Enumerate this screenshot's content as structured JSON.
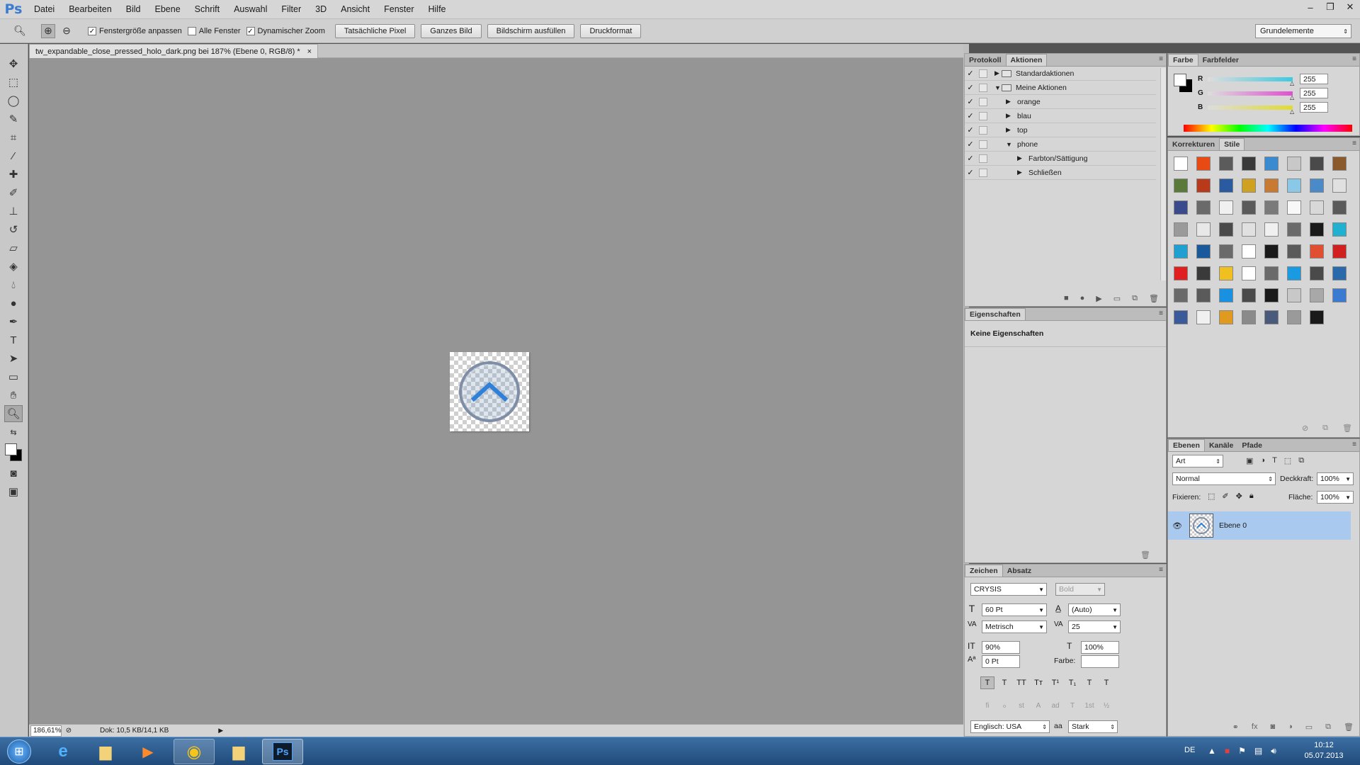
{
  "app": {
    "logo": "Ps",
    "menu": [
      "Datei",
      "Bearbeiten",
      "Bild",
      "Ebene",
      "Schrift",
      "Auswahl",
      "Filter",
      "3D",
      "Ansicht",
      "Fenster",
      "Hilfe"
    ],
    "window_controls": [
      "–",
      "❐",
      "✕"
    ]
  },
  "options": {
    "checks": [
      {
        "label": "Fenstergröße anpassen",
        "checked": true
      },
      {
        "label": "Alle Fenster",
        "checked": false
      },
      {
        "label": "Dynamischer Zoom",
        "checked": true
      }
    ],
    "buttons": [
      "Tatsächliche Pixel",
      "Ganzes Bild",
      "Bildschirm ausfüllen",
      "Druckformat"
    ],
    "workspace": "Grundelemente"
  },
  "document": {
    "tab_title": "tw_expandable_close_pressed_holo_dark.png bei 187% (Ebene 0, RGB/8) *",
    "close": "×",
    "zoom": "186,61%",
    "doc_info": "Dok: 10,5 KB/14,1 KB"
  },
  "actions_panel": {
    "tabs": [
      "Protokoll",
      "Aktionen"
    ],
    "rows": [
      {
        "label": "Standardaktionen",
        "indent": 0,
        "open": false,
        "folder": true
      },
      {
        "label": "Meine Aktionen",
        "indent": 0,
        "open": true,
        "folder": true
      },
      {
        "label": "orange",
        "indent": 1,
        "open": false,
        "folder": false
      },
      {
        "label": "blau",
        "indent": 1,
        "open": false,
        "folder": false
      },
      {
        "label": "top",
        "indent": 1,
        "open": false,
        "folder": false
      },
      {
        "label": "phone",
        "indent": 1,
        "open": true,
        "folder": false
      },
      {
        "label": "Farbton/Sättigung",
        "indent": 2,
        "open": false,
        "folder": false
      },
      {
        "label": "Schließen",
        "indent": 2,
        "open": false,
        "folder": false
      }
    ]
  },
  "properties_panel": {
    "tab": "Eigenschaften",
    "text": "Keine Eigenschaften"
  },
  "character_panel": {
    "tabs": [
      "Zeichen",
      "Absatz"
    ],
    "font": "CRYSIS",
    "style": "Bold",
    "size": "60 Pt",
    "leading": "(Auto)",
    "kerning": "Metrisch",
    "tracking": "25",
    "vscale": "90%",
    "hscale": "100%",
    "baseline": "0 Pt",
    "color_label": "Farbe:",
    "language": "Englisch: USA",
    "aa_label": "aa",
    "antialias": "Stark",
    "style_buttons": [
      "T",
      "T",
      "TT",
      "Tт",
      "T¹",
      "T₁",
      "T",
      "T"
    ],
    "opentype_buttons": [
      "fi",
      "ℴ",
      "st",
      "A",
      "ad",
      "T",
      "1st",
      "½"
    ]
  },
  "color_panel": {
    "tabs": [
      "Farbe",
      "Farbfelder"
    ],
    "channels": [
      {
        "label": "R",
        "value": "255",
        "color": "#3fc9e0"
      },
      {
        "label": "G",
        "value": "255",
        "color": "#e04fd0"
      },
      {
        "label": "B",
        "value": "255",
        "color": "#e0dc30"
      }
    ]
  },
  "styles_panel": {
    "tabs": [
      "Korrekturen",
      "Stile"
    ],
    "swatches": [
      "#ffffff",
      "#e84a14",
      "#5b5b5b",
      "#3a3a3a",
      "#3a8ad0",
      "#c8c8c8",
      "#4a4a4a",
      "#8a5a2a",
      "#5a7a3a",
      "#b83a1a",
      "#2a5aa0",
      "#d0a020",
      "#c87a30",
      "#8ac8e8",
      "#4a8ac8",
      "#e0e0e0",
      "#3a4a8a",
      "#6a6a6a",
      "#f0f0f0",
      "#5a5a5a",
      "#7a7a7a",
      "#f8f8f8",
      "#d8d8d8",
      "#5a5a5a",
      "#9a9a9a",
      "#e8e8e8",
      "#4a4a4a",
      "#e0e0e0",
      "#f0f0f0",
      "#6a6a6a",
      "#1a1a1a",
      "#20b0d0",
      "#20a0d0",
      "#1a5a9a",
      "#6a6a6a",
      "#ffffff",
      "#1a1a1a",
      "#5a5a5a",
      "#e05030",
      "#d02020",
      "#e02020",
      "#3a3a3a",
      "#f0c020",
      "#ffffff",
      "#6a6a6a",
      "#1a9ae0",
      "#4a4a4a",
      "#2a6aaa",
      "#6a6a6a",
      "#5a5a5a",
      "#1a90e0",
      "#4a4a4a",
      "#1a1a1a",
      "#c8c8c8",
      "#a8a8a8",
      "#3a7ad0",
      "#3a5a9a",
      "#f0f0f0",
      "#e09a20",
      "#8a8a8a",
      "#4a5a7a",
      "#9a9a9a",
      "#1a1a1a"
    ]
  },
  "layers_panel": {
    "tabs": [
      "Ebenen",
      "Kanäle",
      "Pfade"
    ],
    "filter": "Art",
    "blend": "Normal",
    "opacity_label": "Deckkraft:",
    "opacity": "100%",
    "lock_label": "Fixieren:",
    "fill_label": "Fläche:",
    "fill": "100%",
    "layers": [
      {
        "name": "Ebene 0",
        "visible": true,
        "selected": true
      }
    ]
  },
  "taskbar": {
    "lang": "DE",
    "time": "10:12",
    "date": "05.07.2013"
  }
}
